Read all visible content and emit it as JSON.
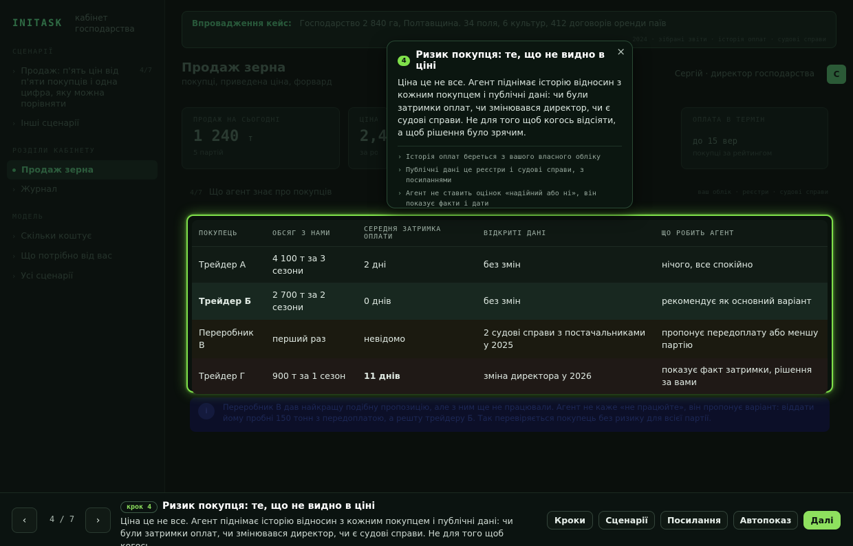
{
  "sidebar": {
    "logo": "INITASK",
    "subtitle": "кабінет\nгосподарства",
    "section1": "СЦЕНАРІЇ",
    "item_sale_story": "Продаж: п'ять цін від п'яти покупців і одна цифра, яку можна порівняти",
    "item_sale_story_count": "4/7",
    "item_other": "Інші сценарії",
    "section2": "РОЗДІЛИ КАБІНЕТУ",
    "item_grain_sale": "Продаж зерна",
    "item_journal": "Журнал",
    "section3": "МОДЕЛЬ",
    "item_cost": "Скільки коштує",
    "item_needs": "Що потрібно від вас",
    "item_all": "Усі сценарії"
  },
  "banner": {
    "label": "Впровадження кейс:",
    "text": "Господарство 2 840 га, Полтавщина. 34 поля, 6 культур, 412 договорів оренди паїв",
    "tags": "2024 · зібрані звіти · історія оплат · судові справи"
  },
  "page": {
    "title": "Продаж зерна",
    "subtitle": "покупці, приведена ціна, форвард",
    "user": "Сергій · директор господарства",
    "avatar": "С"
  },
  "stats": {
    "s1_label": "ПРОДАЖ НА СЬОГОДНІ",
    "s1_value": "1 240",
    "s1_unit": "т",
    "s1_note": "5 партій",
    "s2_label": "ЦІНА",
    "s2_value": "2,4",
    "s2_note": "за розрахунком агента",
    "s3_label": "ОПЛАТА В ТЕРМІН",
    "s3_value": "до 15 вер",
    "s3_note": "покупці за рейтингом"
  },
  "section": {
    "num": "4/7",
    "title": "Що агент знає про покупців",
    "right": "ваш облік · реєстри · судові справи"
  },
  "table": {
    "headers": [
      "ПОКУПЕЦЬ",
      "ОБСЯГ З НАМИ",
      "СЕРЕДНЯ ЗАТРИМКА ОПЛАТИ",
      "ВІДКРИТІ ДАНІ",
      "ЩО РОБИТЬ АГЕНТ"
    ],
    "rows": [
      [
        "Трейдер А",
        "4 100 т за 3 сезони",
        "2 дні",
        "без змін",
        "нічого, все спокійно"
      ],
      [
        "Трейдер Б",
        "2 700 т за 2 сезони",
        "0 днів",
        "без змін",
        "рекомендує як основний варіант"
      ],
      [
        "Переробник В",
        "перший раз",
        "невідомо",
        "2 судові справи з постачальниками у 2025",
        "пропонує передоплату або меншу партію"
      ],
      [
        "Трейдер Г",
        "900 т за 1 сезон",
        "11 днів",
        "зміна директора у 2026",
        "показує факт затримки, рішення за вами"
      ]
    ]
  },
  "note": {
    "num": "i",
    "text": "Переробник В дав найкращу подібну пропозицію, але з ним ще не працювали. Агент не каже «не працюйте», він пропонує варіант: віддати йому пробні 150 тонн з передоплатою, а решту трейдеру Б. Так перевіряється покупець без ризику для всієї партії."
  },
  "popover": {
    "num": "4",
    "title": "Ризик покупця: те, що не видно в ціні",
    "close": "×",
    "text": "Ціна це не все. Агент піднімає історію відносин з кожним покупцем і публічні дані: чи були затримки оплат, чи змінювався директор, чи є судові справи. Не для того щоб когось відсіяти, а щоб рішення було зрячим.",
    "bullets": [
      "Історія оплат береться з вашого власного обліку",
      "Публічні дані це реєстри і судові справи, з посиланнями",
      "Агент не ставить оцінок «надійний або ні», він показує факти і дати"
    ]
  },
  "bottombar": {
    "prev": "‹",
    "next": "›",
    "counter": "4 / 7",
    "step_label": "крок 4",
    "title": "Ризик покупця: те, що не видно в ціні",
    "text": "Ціна це не все. Агент піднімає історію відносин з кожним покупцем і публічні дані: чи були затримки оплат, чи змінювався директор, чи є судові справи. Не для того щоб когось...",
    "btn_steps": "Кроки",
    "btn_scenarios": "Сценарії",
    "btn_links": "Посилання",
    "btn_autoplay": "Автопоказ",
    "btn_next": "Далі"
  },
  "colors": {
    "accent": "#8ee05e",
    "highlight_border": "#7fe04a",
    "warn": "#e5a637",
    "danger": "#ef6b5f"
  }
}
